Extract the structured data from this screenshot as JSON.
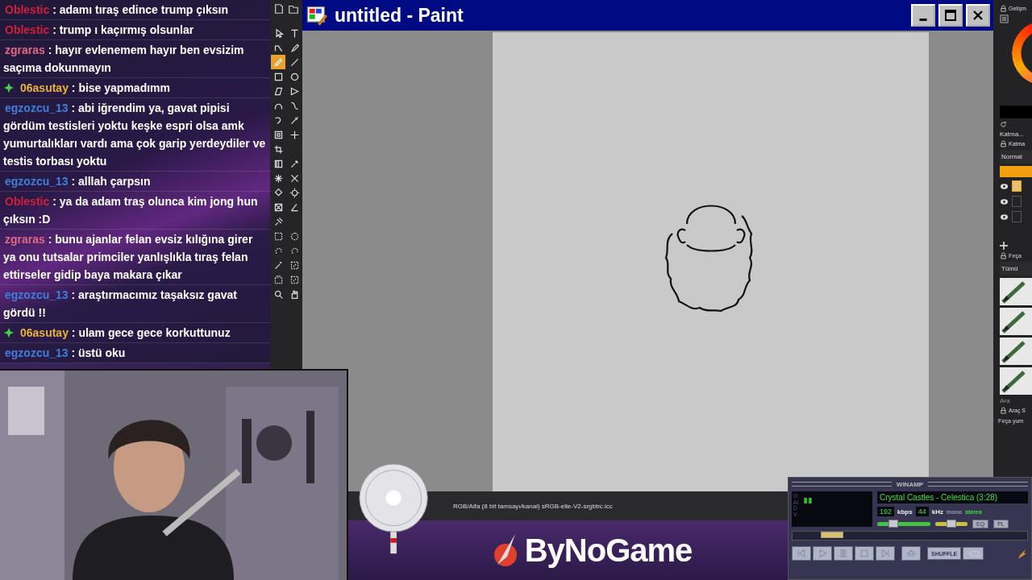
{
  "chat": {
    "messages": [
      {
        "user": "Oblestic",
        "color": "#d0203a",
        "badge": false,
        "text": ": adamı tıraş edince trump çıksın"
      },
      {
        "user": "Oblestic",
        "color": "#d0203a",
        "badge": false,
        "text": ": trump ı kaçırmış olsunlar"
      },
      {
        "user": "zgraras",
        "color": "#e06a82",
        "badge": false,
        "text": ": hayır evlenemem hayır ben evsizim saçıma dokunmayın"
      },
      {
        "user": "06asutay",
        "color": "#e8b040",
        "badge": true,
        "text": ": bise yapmadımm"
      },
      {
        "user": "egzozcu_13",
        "color": "#3f7fd8",
        "badge": false,
        "text": ": abi iğrendim ya, gavat pipisi gördüm testisleri yoktu keşke espri olsa amk yumurtalıkları vardı ama çok garip yerdeydiler ve testis torbası yoktu"
      },
      {
        "user": "egzozcu_13",
        "color": "#3f7fd8",
        "badge": false,
        "text": ": alllah çarpsın"
      },
      {
        "user": "Oblestic",
        "color": "#d0203a",
        "badge": false,
        "text": ": ya da adam traş olunca kim jong hun çıksın :D"
      },
      {
        "user": "zgraras",
        "color": "#e06a82",
        "badge": false,
        "text": ": bunu ajanlar felan evsiz kılığına girer ya onu tutsalar primciler yanlışlıkla tıraş felan ettirseler gidip baya makara çıkar"
      },
      {
        "user": "egzozcu_13",
        "color": "#3f7fd8",
        "badge": false,
        "text": ": araştırmacımız taşaksız gavat gördü !!"
      },
      {
        "user": "06asutay",
        "color": "#e8b040",
        "badge": true,
        "text": ": ulam gece gece korkuttunuz"
      },
      {
        "user": "egzozcu_13",
        "color": "#3f7fd8",
        "badge": false,
        "text": ": üstü oku"
      }
    ]
  },
  "toolbox": {
    "tools": [
      {
        "kind": "pointer",
        "selected": false
      },
      {
        "kind": "text",
        "selected": false
      },
      {
        "kind": "path",
        "selected": false
      },
      {
        "kind": "pen",
        "selected": false
      },
      {
        "kind": "pencil",
        "selected": true
      },
      {
        "kind": "line",
        "selected": false
      },
      {
        "kind": "rectangle",
        "selected": false
      },
      {
        "kind": "ellipse",
        "selected": false
      },
      {
        "kind": "polygon",
        "selected": false
      },
      {
        "kind": "triangle",
        "selected": false
      },
      {
        "kind": "curve",
        "selected": false
      },
      {
        "kind": "bezier",
        "selected": false
      },
      {
        "kind": "spiral",
        "selected": false
      },
      {
        "kind": "brush",
        "selected": false
      },
      {
        "kind": "transform",
        "selected": false
      },
      {
        "kind": "move",
        "selected": false
      },
      {
        "kind": "crop",
        "selected": false
      },
      {
        "kind": "blank"
      },
      {
        "kind": "gradient",
        "selected": false
      },
      {
        "kind": "eyedropper",
        "selected": false
      },
      {
        "kind": "sparkle",
        "selected": false
      },
      {
        "kind": "scissors",
        "selected": false
      },
      {
        "kind": "bucket",
        "selected": false
      },
      {
        "kind": "gear",
        "selected": false
      },
      {
        "kind": "warp",
        "selected": false
      },
      {
        "kind": "angle",
        "selected": false
      },
      {
        "kind": "pin",
        "selected": false
      },
      {
        "kind": "blank"
      },
      {
        "kind": "rectselect",
        "selected": false
      },
      {
        "kind": "ellipseselect",
        "selected": false
      },
      {
        "kind": "lasso",
        "selected": false
      },
      {
        "kind": "lasso",
        "selected": false
      },
      {
        "kind": "wand",
        "selected": false
      },
      {
        "kind": "selectedit",
        "selected": false
      },
      {
        "kind": "selectbox",
        "selected": false
      },
      {
        "kind": "selectedit",
        "selected": false
      },
      {
        "kind": "zoom",
        "selected": false
      },
      {
        "kind": "hand",
        "selected": false
      }
    ]
  },
  "paint": {
    "title": "untitled - Paint",
    "status": "RGB/Alfa (8 bit tamsayı/kanal) sRGB-elle-V2-srgbtrc.icc"
  },
  "panel": {
    "header": "Gelişm",
    "tab": "Katma...",
    "layers_title": "Katma",
    "mode": "Normal",
    "layers": [
      {
        "selected": true
      },
      {
        "selected": false
      },
      {
        "selected": false
      }
    ],
    "brushes_title": "Fırça",
    "filter": "Tümü",
    "search": "Ara",
    "tool_title": "Araç S",
    "tool_option": "Fırça yum"
  },
  "banner": {
    "logo": "ByNoGame"
  },
  "winamp": {
    "title": "WINAMP",
    "vis_letters": "OAIDV",
    "track": "Crystal Castles - Celestica (3:28)",
    "kbps": "192",
    "kbps_unit": "kbps",
    "khz": "44",
    "khz_unit": "kHz",
    "modes": [
      {
        "label": "mono",
        "selected": false
      },
      {
        "label": "stereo",
        "selected": true
      }
    ],
    "volume": {
      "level": 0.3
    },
    "balance": {
      "level": 0.5
    },
    "toggles": [
      {
        "label": "EQ",
        "on": false
      },
      {
        "label": "PL",
        "on": false
      }
    ],
    "seek": {
      "level": 0.17
    },
    "shuffle": "SHUFFLE"
  }
}
